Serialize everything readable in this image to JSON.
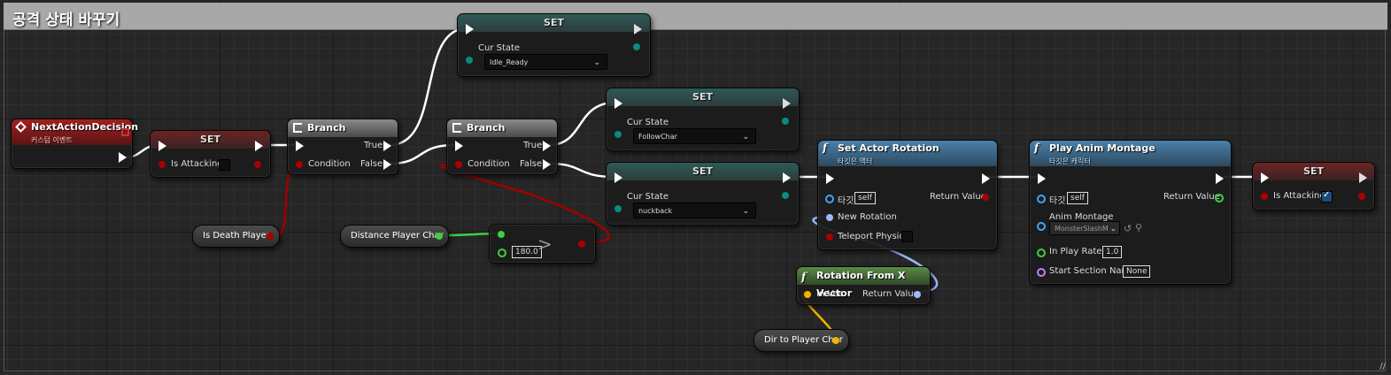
{
  "comment": {
    "title": "공격 상태 바꾸기"
  },
  "nodes": {
    "event_next": {
      "title": "NextActionDecision",
      "subtitle": "커스텀 이벤트"
    },
    "set_attacking_1": {
      "title": "SET",
      "var": "Is Attacking",
      "checked": false
    },
    "branch_1": {
      "title": "Branch",
      "true": "True",
      "false": "False",
      "condition": "Condition"
    },
    "branch_2": {
      "title": "Branch",
      "true": "True",
      "false": "False",
      "condition": "Condition"
    },
    "set_idle": {
      "title": "SET",
      "var": "Cur State",
      "value": "Idle_Ready"
    },
    "set_follow": {
      "title": "SET",
      "var": "Cur State",
      "value": "FollowChar"
    },
    "set_knockback": {
      "title": "SET",
      "var": "Cur State",
      "value": "nuckback"
    },
    "is_death": {
      "label": "Is Death Player"
    },
    "distance": {
      "label": "Distance Player Char"
    },
    "greater": {
      "value": "180.0",
      "op": ">"
    },
    "set_rotation": {
      "title": "Set Actor Rotation",
      "subtitle": "타깃은 액터",
      "target": "타깃",
      "self": "self",
      "return": "Return Value",
      "new_rotation": "New Rotation",
      "teleport": "Teleport Physics"
    },
    "rotation_from_x": {
      "title": "Rotation From X Vector",
      "in_vec": "In Vec",
      "return": "Return Value"
    },
    "dir_to_player": {
      "label": "Dir to Player Char"
    },
    "play_montage": {
      "title": "Play Anim Montage",
      "subtitle": "타깃은 캐릭터",
      "target": "타깃",
      "self": "self",
      "return": "Return Value",
      "anim_montage": "Anim Montage",
      "montage_value": "MonsterSlashM",
      "play_rate": "In Play Rate",
      "play_rate_value": "1.0",
      "start_section": "Start Section Name",
      "start_section_value": "None"
    },
    "set_attacking_2": {
      "title": "SET",
      "var": "Is Attacking",
      "checked": true
    }
  },
  "colors": {
    "exec": "#ffffff",
    "bool": "#a00000",
    "float": "#3fcf3f",
    "vector": "#f0b400",
    "rotator": "#9fb7ff",
    "object": "#3aa6ff",
    "enum": "#0a8a80"
  }
}
